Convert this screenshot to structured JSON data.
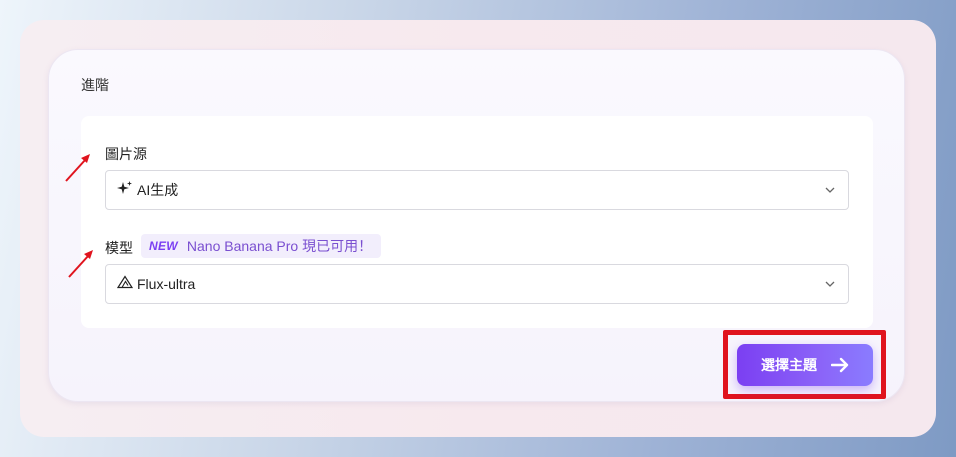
{
  "section": {
    "title": "進階"
  },
  "image_source": {
    "label": "圖片源",
    "selected": "AI生成",
    "icon": "sparkle-icon"
  },
  "model": {
    "label": "模型",
    "badge_new": "NEW",
    "badge_message": "Nano Banana Pro 現已可用！",
    "selected": "Flux-ultra",
    "icon": "flux-triangle-icon"
  },
  "actions": {
    "choose_theme_label": "選擇主題",
    "choose_theme_icon": "arrow-right-icon"
  },
  "colors": {
    "accent": "#7b3ff2",
    "annotation_red": "#e0141e"
  }
}
